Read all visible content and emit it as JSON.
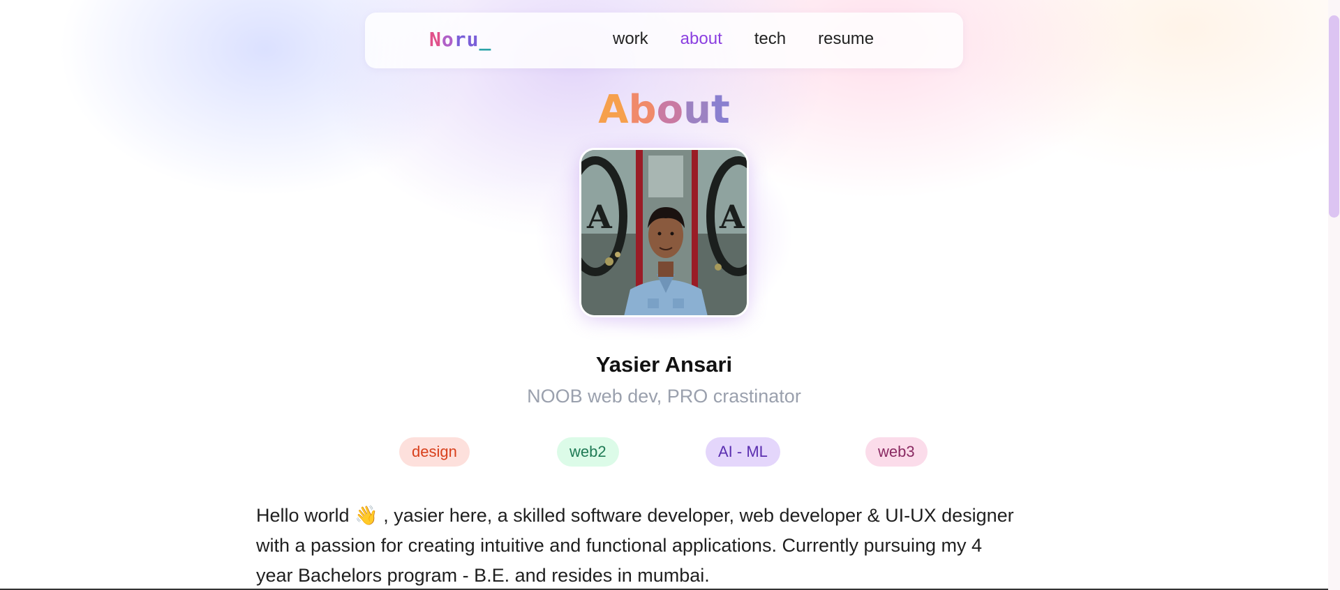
{
  "nav": {
    "logo": {
      "part1": "N",
      "part2": "o",
      "part3": "ru",
      "cursor": "_"
    },
    "links": [
      {
        "label": "work",
        "active": false
      },
      {
        "label": "about",
        "active": true
      },
      {
        "label": "tech",
        "active": false
      },
      {
        "label": "resume",
        "active": false
      }
    ]
  },
  "page": {
    "title_letters": [
      "A",
      "b",
      "o",
      "u",
      "t"
    ],
    "title_colors": [
      "#f6a04d",
      "#f08a6a",
      "#c97aa2",
      "#9c82c2",
      "#8a7fcf"
    ]
  },
  "profile": {
    "photo_alt": "profile-photo",
    "name": "Yasier Ansari",
    "tagline": "NOOB web dev, PRO crastinator"
  },
  "tags": [
    {
      "label": "design",
      "bg": "#fde0dc",
      "color": "#d8401c"
    },
    {
      "label": "web2",
      "bg": "#dcfbe8",
      "color": "#1f7a55"
    },
    {
      "label": "AI - ML",
      "bg": "#e4d6fb",
      "color": "#5b2fb0"
    },
    {
      "label": "web3",
      "bg": "#fbdcea",
      "color": "#8a2a62"
    }
  ],
  "bio": {
    "line1_before_emoji": "Hello world",
    "emoji": "👋",
    "line1_after_emoji": ", yasier here, a skilled software developer, web developer & UI-UX designer",
    "line2": "with a passion for creating intuitive and functional applications. Currently pursuing my 4",
    "line3": "year Bachelors program - B.E. and resides in mumbai."
  },
  "colors": {
    "accent": "#8b3fe0",
    "scroll_thumb": "#dcc4f2"
  }
}
